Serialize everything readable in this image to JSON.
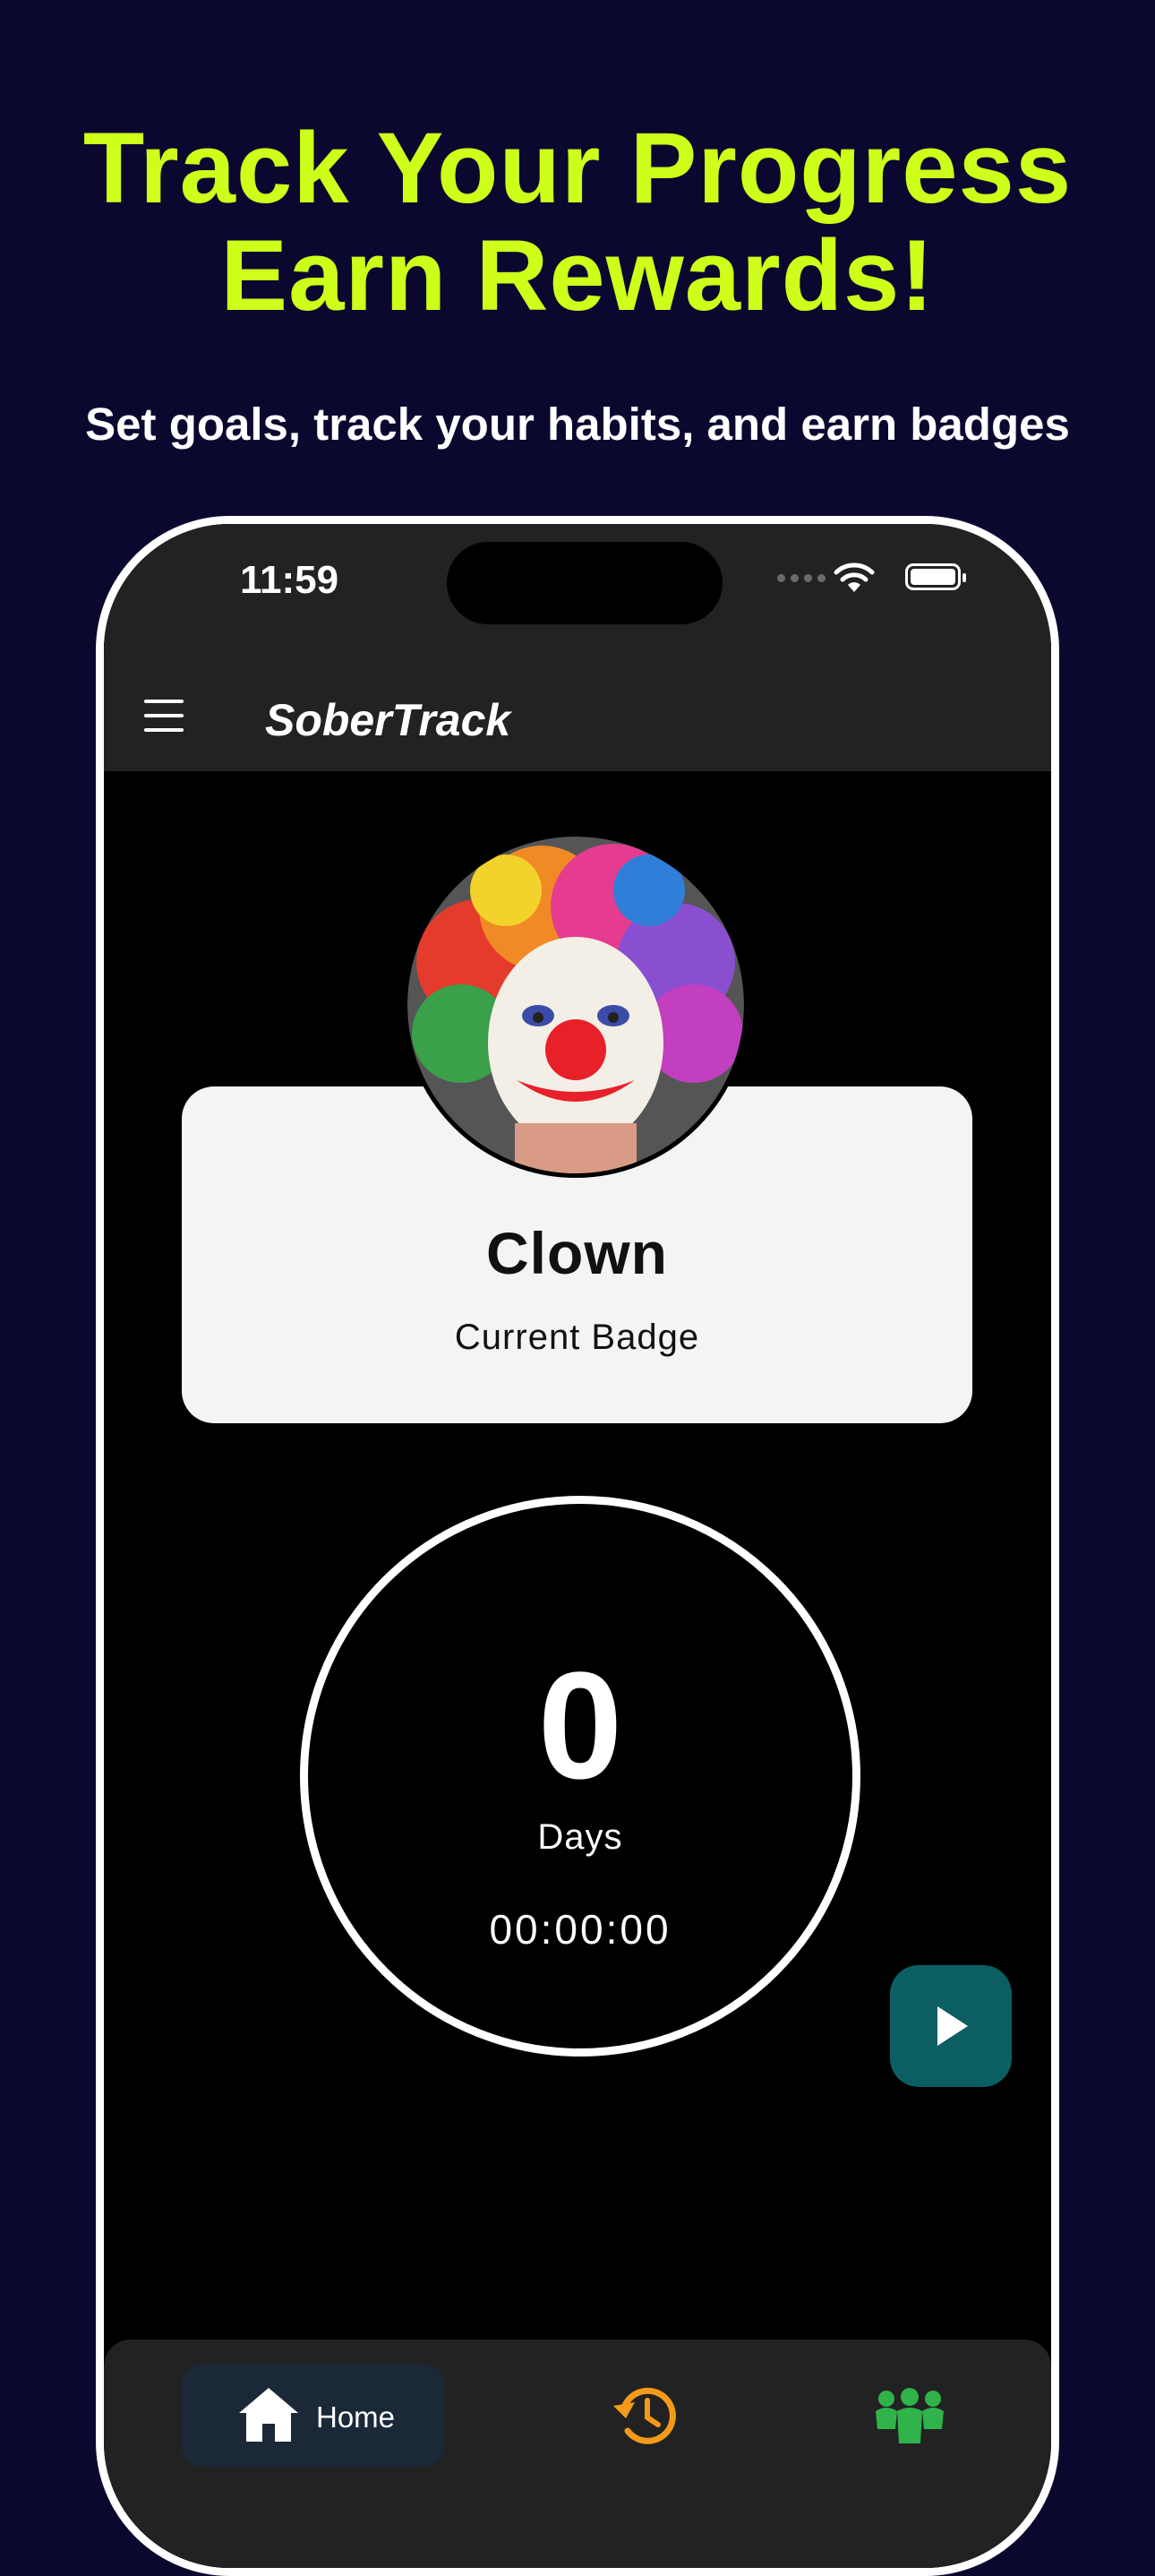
{
  "marketing": {
    "headline_line1": "Track Your Progress",
    "headline_line2": "Earn Rewards!",
    "subheadline": "Set goals, track your habits, and earn badges"
  },
  "status_bar": {
    "time": "11:59"
  },
  "app_bar": {
    "title": "SoberTrack",
    "menu_icon": "hamburger-icon"
  },
  "badge": {
    "name": "Clown",
    "label": "Current Badge",
    "image": "clown-avatar"
  },
  "timer": {
    "days": "0",
    "days_label": "Days",
    "clock": "00:00:00"
  },
  "fab": {
    "icon": "play-icon"
  },
  "bottom_nav": {
    "items": [
      {
        "label": "Home",
        "icon": "home-icon",
        "active": true
      },
      {
        "label": "",
        "icon": "history-icon",
        "active": false
      },
      {
        "label": "",
        "icon": "community-icon",
        "active": false
      }
    ]
  },
  "colors": {
    "page_bg": "#0b0830",
    "accent": "#cdff1a",
    "fab": "#0b5f62",
    "history_icon": "#f39a1b",
    "community_icon": "#2fb34a"
  }
}
